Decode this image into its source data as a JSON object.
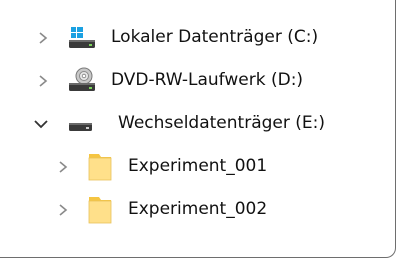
{
  "tree": {
    "items": [
      {
        "label": "Lokaler Datenträger (C:)",
        "expanded": false,
        "icon": "system-drive-icon"
      },
      {
        "label": "DVD-RW-Laufwerk (D:)",
        "expanded": false,
        "icon": "dvd-drive-icon"
      },
      {
        "label": "Wechseldatenträger (E:)",
        "expanded": true,
        "icon": "removable-drive-icon"
      },
      {
        "label": "Experiment_001",
        "expanded": false,
        "icon": "folder-icon"
      },
      {
        "label": "Experiment_002",
        "expanded": false,
        "icon": "folder-icon"
      }
    ]
  },
  "colors": {
    "chevron": "#8a8a8a",
    "chevron_expanded": "#333333",
    "folder": "#ffe08a",
    "windows_logo": "#1ba1e2",
    "drive_body": "#3a3a3a"
  }
}
